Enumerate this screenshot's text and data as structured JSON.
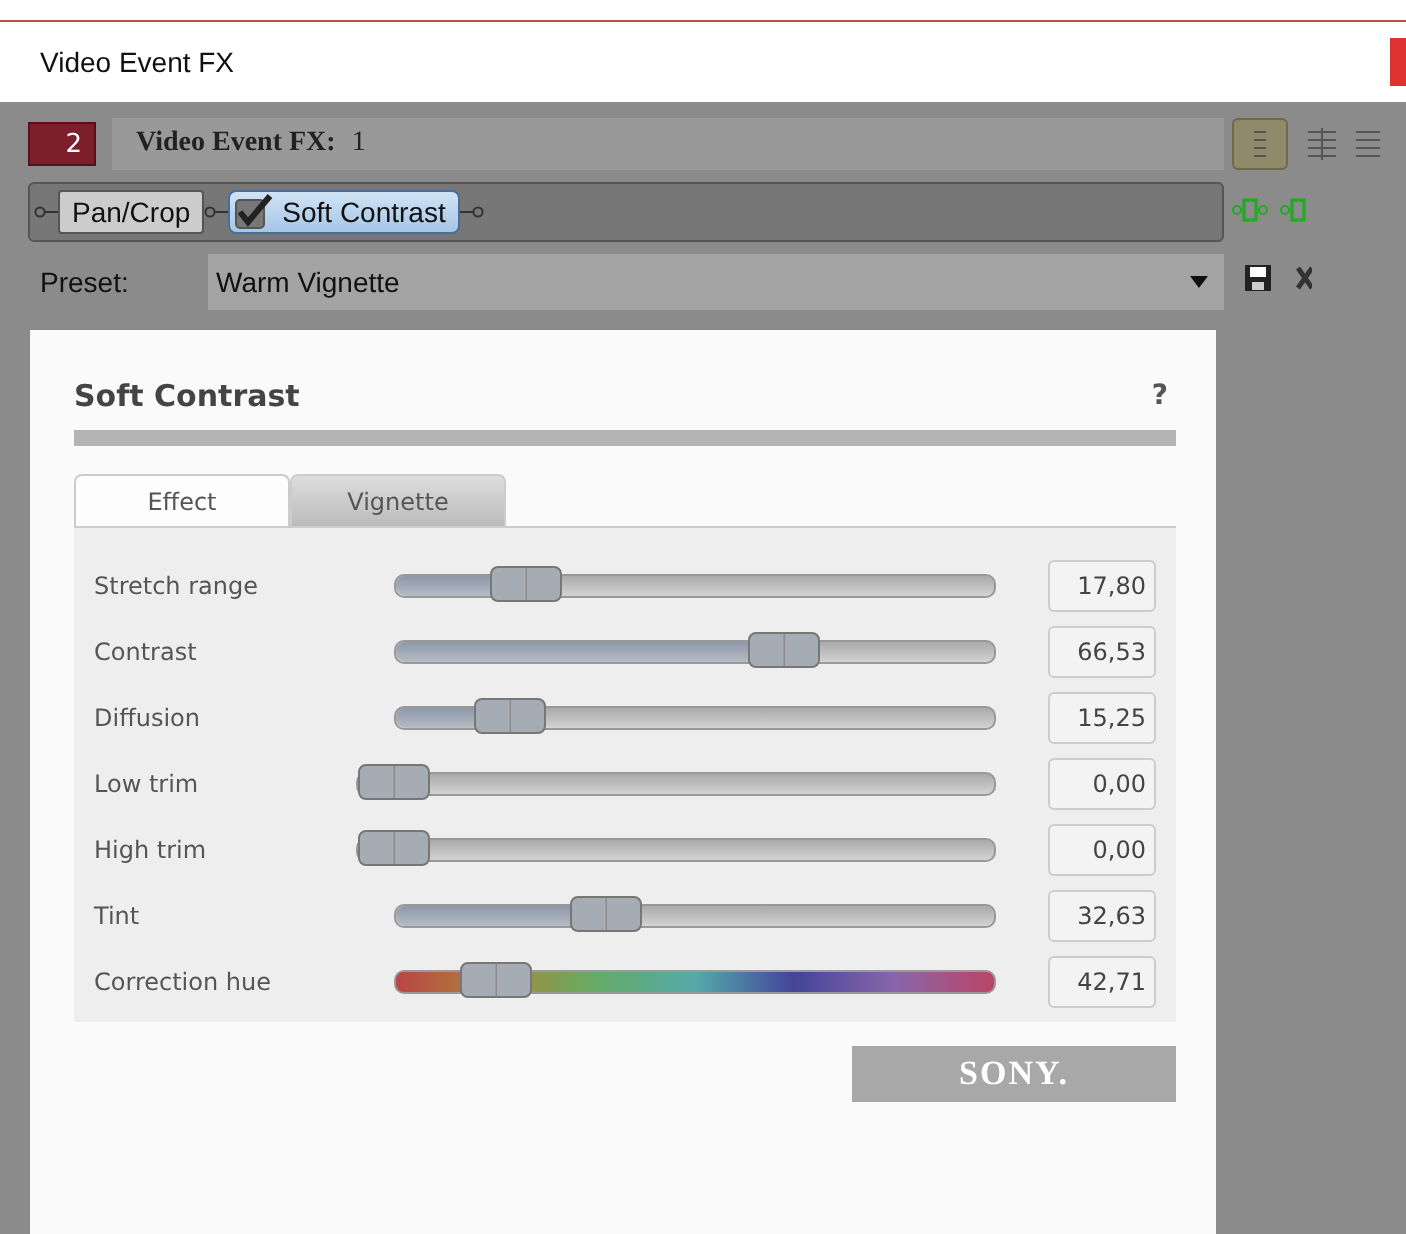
{
  "window": {
    "title": "Video Event FX"
  },
  "header": {
    "badge": "2",
    "label": "Video Event FX:",
    "count": "1"
  },
  "chain": [
    {
      "label": "Pan/Crop",
      "selected": false,
      "checked": false
    },
    {
      "label": "Soft Contrast",
      "selected": true,
      "checked": true
    }
  ],
  "preset": {
    "label": "Preset:",
    "value": "Warm Vignette"
  },
  "plugin": {
    "title": "Soft Contrast",
    "help": "?",
    "tabs": [
      {
        "label": "Effect",
        "selected": true
      },
      {
        "label": "Vignette",
        "selected": false
      }
    ],
    "sliders": [
      {
        "label": "Stretch range",
        "kind": "normal",
        "level": 0.18,
        "reading": "17,80"
      },
      {
        "label": "Contrast",
        "kind": "normal",
        "level": 0.67,
        "reading": "66,53"
      },
      {
        "label": "Diffusion",
        "kind": "normal",
        "level": 0.15,
        "reading": "15,25"
      },
      {
        "label": "Low trim",
        "kind": "wide",
        "level": 0,
        "reading": "0,00"
      },
      {
        "label": "High trim",
        "kind": "wide",
        "level": 0,
        "reading": "0,00"
      },
      {
        "label": "Tint",
        "kind": "normal",
        "level": 0.33,
        "reading": "32,63"
      },
      {
        "label": "Correction hue",
        "kind": "hue",
        "level": 0.12,
        "reading": "42,71"
      }
    ],
    "brand": "SONY."
  }
}
